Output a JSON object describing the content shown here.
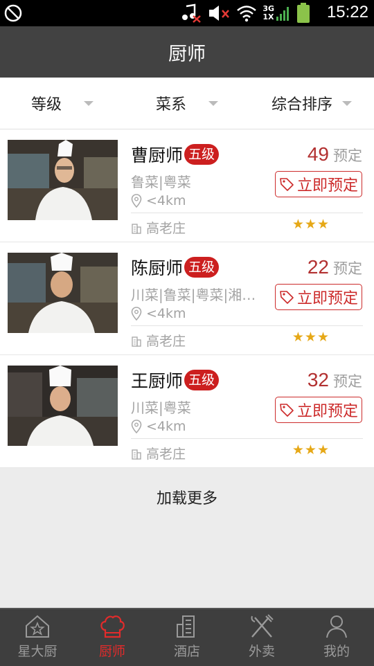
{
  "status_bar": {
    "time": "15:22",
    "network": "3G",
    "network_sub": "1X"
  },
  "header": {
    "title": "厨师"
  },
  "filters": [
    {
      "label": "等级"
    },
    {
      "label": "菜系"
    },
    {
      "label": "综合排序"
    }
  ],
  "chefs": [
    {
      "name": "曹厨师",
      "level": "五级",
      "cuisine": "鲁菜|粤菜",
      "distance": "<4km",
      "area": "高老庄",
      "bookings": "49",
      "bookings_label": "预定",
      "book_label": "立即预定",
      "rating": 3
    },
    {
      "name": "陈厨师",
      "level": "五级",
      "cuisine": "川菜|鲁菜|粤菜|湘菜…",
      "distance": "<4km",
      "area": "高老庄",
      "bookings": "22",
      "bookings_label": "预定",
      "book_label": "立即预定",
      "rating": 3
    },
    {
      "name": "王厨师",
      "level": "五级",
      "cuisine": "川菜|粤菜",
      "distance": "<4km",
      "area": "高老庄",
      "bookings": "32",
      "bookings_label": "预定",
      "book_label": "立即预定",
      "rating": 3
    }
  ],
  "load_more": "加载更多",
  "tabs": [
    {
      "label": "星大厨",
      "icon": "house-star-icon",
      "active": false
    },
    {
      "label": "厨师",
      "icon": "chef-hat-icon",
      "active": true
    },
    {
      "label": "酒店",
      "icon": "building-icon",
      "active": false
    },
    {
      "label": "外卖",
      "icon": "fork-knife-icon",
      "active": false
    },
    {
      "label": "我的",
      "icon": "person-icon",
      "active": false
    }
  ],
  "colors": {
    "accent": "#cc2a2a",
    "header_bg": "#424242",
    "star": "#e6a817"
  }
}
